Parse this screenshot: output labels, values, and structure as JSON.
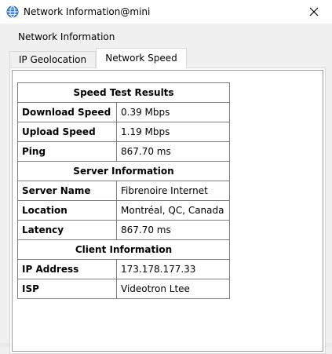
{
  "window": {
    "title": "Network Information@mini",
    "icon": "globe-icon",
    "close_glyph": "✕"
  },
  "group": {
    "label": "Network Information"
  },
  "tabs": [
    {
      "label": "IP Geolocation",
      "active": false
    },
    {
      "label": "Network Speed",
      "active": true
    }
  ],
  "speed_table": {
    "sections": [
      {
        "header": "Speed Test Results",
        "rows": [
          {
            "key": "Download Speed",
            "value": "0.39 Mbps"
          },
          {
            "key": "Upload Speed",
            "value": "1.19 Mbps"
          },
          {
            "key": "Ping",
            "value": "867.70 ms"
          }
        ]
      },
      {
        "header": "Server Information",
        "rows": [
          {
            "key": "Server Name",
            "value": "Fibrenoire Internet"
          },
          {
            "key": "Location",
            "value": "Montréal, QC, Canada"
          },
          {
            "key": "Latency",
            "value": "867.70 ms"
          }
        ]
      },
      {
        "header": "Client Information",
        "rows": [
          {
            "key": "IP Address",
            "value": "173.178.177.33"
          },
          {
            "key": "ISP",
            "value": "Videotron Ltee"
          }
        ]
      }
    ]
  },
  "colors": {
    "window_bg": "#f0f0f0",
    "titlebar_bg": "#ffffff",
    "icon_blue": "#3f7fd8",
    "grid_line": "#808080"
  }
}
